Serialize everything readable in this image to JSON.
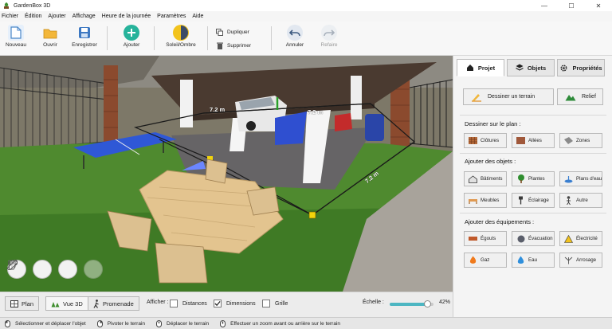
{
  "window": {
    "title": "GardenBox 3D"
  },
  "menu": [
    "Fichier",
    "Édition",
    "Ajouter",
    "Affichage",
    "Heure de la journée",
    "Paramètres",
    "Aide"
  ],
  "toolbar": {
    "nouveau": "Nouveau",
    "ouvrir": "Ouvrir",
    "enregistrer": "Enregistrer",
    "ajouter": "Ajouter",
    "soleil": "Soleil/Ombre",
    "dupliquer": "Dupliquer",
    "supprimer": "Supprimer",
    "annuler": "Annuler",
    "refaire": "Refaire"
  },
  "view3d": {
    "dimensions": [
      "7.2 m",
      "7.2 m",
      "7.2 m"
    ]
  },
  "right_panel": {
    "tabs": {
      "projet": "Projet",
      "objets": "Objets",
      "proprietes": "Propriétés"
    },
    "dessiner_terrain": "Dessiner un terrain",
    "relief": "Relief",
    "section_plan": "Dessiner sur le plan :",
    "plan_items": [
      "Clôtures",
      "Allées",
      "Zones"
    ],
    "section_objets": "Ajouter des objets :",
    "objets_items": [
      "Bâtiments",
      "Plantes",
      "Plans d'eau",
      "Meubles",
      "Éclairage",
      "Autre"
    ],
    "section_equipements": "Ajouter des équipements :",
    "equipements_items": [
      "Égouts",
      "Évacuation",
      "Électricité",
      "Gaz",
      "Eau",
      "Arrosage"
    ]
  },
  "bottom": {
    "plan": "Plan",
    "vue3d": "Vue 3D",
    "promenade": "Promenade",
    "afficher": "Afficher :",
    "distances": "Distances",
    "dimensions": "Dimensions",
    "grille": "Grille",
    "echelle": "Échelle :",
    "scale_percent": "42%",
    "scale_value": 0.42,
    "checks": {
      "distances": false,
      "dimensions": true,
      "grille": false
    }
  },
  "status": [
    "Sélectionner et déplacer l'objet",
    "Pivoter le terrain",
    "Déplacer le terrain",
    "Effectuer un zoom avant ou arrière sur le terrain"
  ],
  "colors": {
    "accent": "#4db6c2",
    "grass": "#4f8a2f",
    "terrain_outline": "#1a1a1a",
    "marker_yellow": "#f2d40b",
    "roof": "#4a3a30",
    "table_blue": "#2f58d6",
    "wood": "#e3c48f"
  }
}
